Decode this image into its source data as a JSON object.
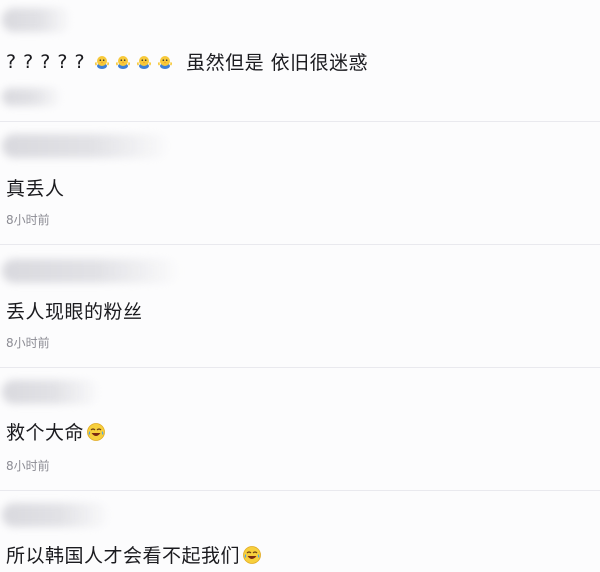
{
  "comments": [
    {
      "text_prefix": "? ? ? ? ?",
      "emojis": [
        "chick-icon",
        "chick-icon",
        "chick-icon",
        "chick-icon"
      ],
      "text_suffix": "虽然但是 依旧很迷惑",
      "timestamp": ""
    },
    {
      "text": "真丢人",
      "timestamp": "8小时前"
    },
    {
      "text": "丢人现眼的粉丝",
      "timestamp": "8小时前"
    },
    {
      "text": "救个大命",
      "emoji": "laughing-crying-face-icon",
      "timestamp": "8小时前"
    },
    {
      "text": "所以韩国人才会看不起我们",
      "emoji": "laughing-crying-face-icon",
      "timestamp": ""
    }
  ],
  "colors": {
    "background": "#fcfcfd",
    "text": "#1b1b1f",
    "timestamp": "#8c8c94",
    "divider": "#e9e9ee",
    "chick_yellow": "#f7c93a",
    "chick_blue": "#3d7fd6"
  }
}
